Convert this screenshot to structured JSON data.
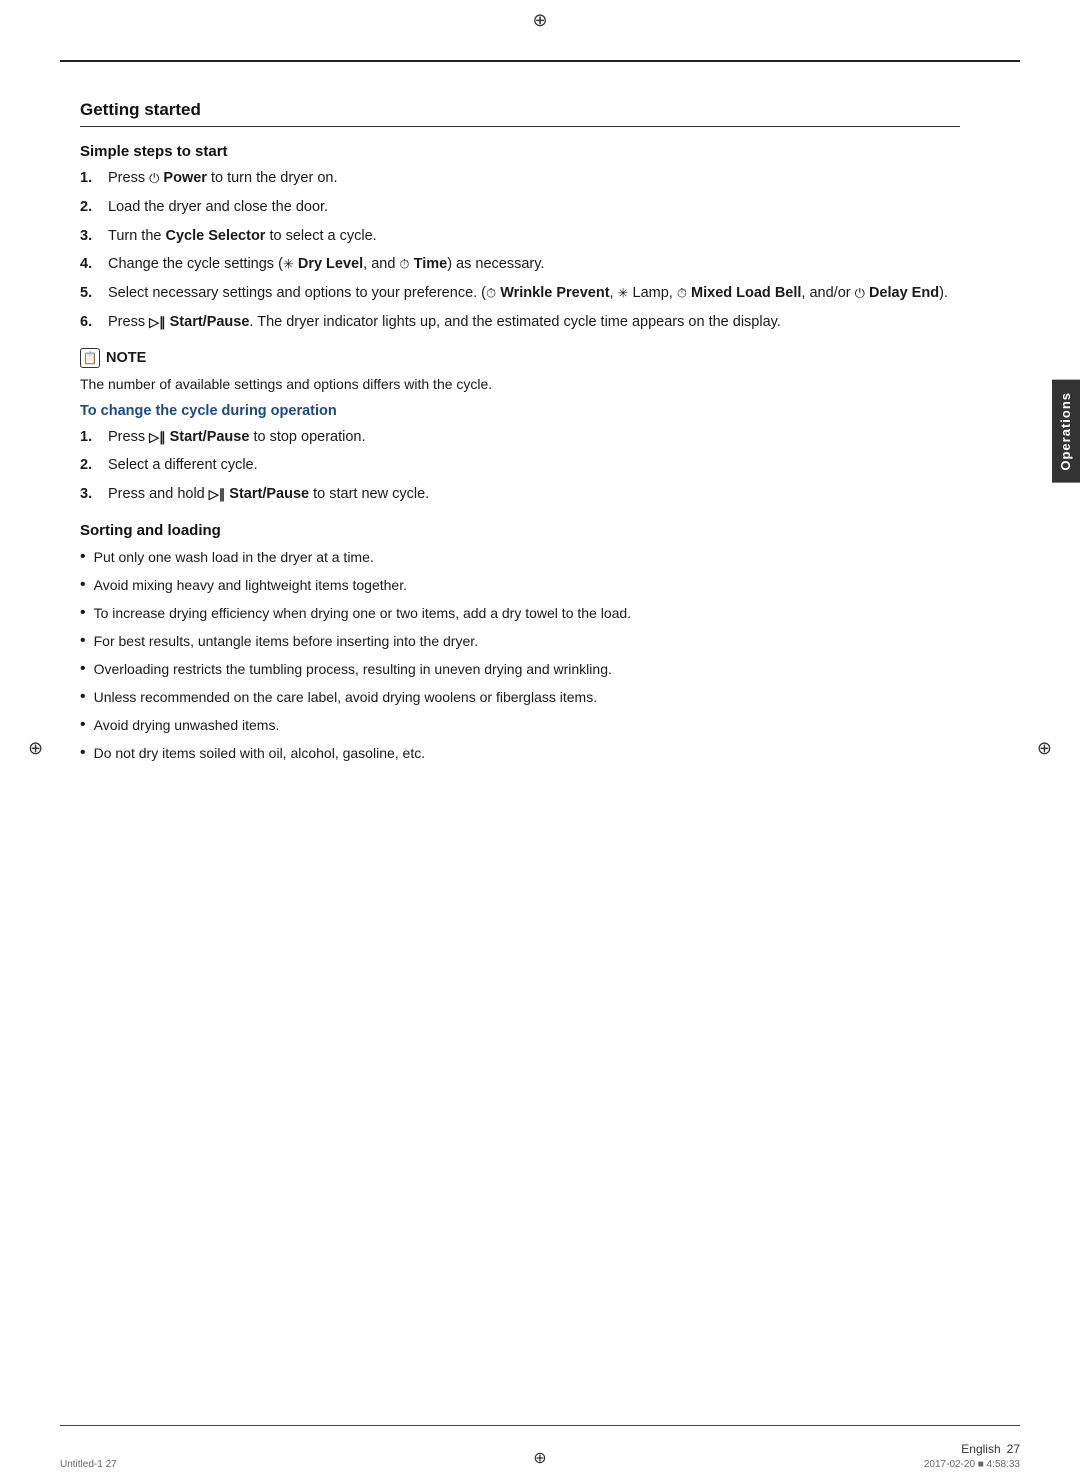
{
  "page": {
    "top_compass": "⊕",
    "left_compass": "⊕",
    "right_compass": "⊕",
    "bottom_compass": "⊕"
  },
  "sidebar": {
    "label": "Operations"
  },
  "section": {
    "title": "Getting started",
    "subsection1": {
      "title": "Simple steps to start",
      "steps": [
        {
          "num": "1.",
          "text": "Press ⏻ Power to turn the dryer on.",
          "bold_parts": [
            "Power"
          ]
        },
        {
          "num": "2.",
          "text": "Load the dryer and close the door."
        },
        {
          "num": "3.",
          "text": "Turn the Cycle Selector to select a cycle.",
          "bold_parts": [
            "Cycle Selector"
          ]
        },
        {
          "num": "4.",
          "text": "Change the cycle settings (✳ Dry Level, and ⏱ Time) as necessary.",
          "bold_parts": [
            "Dry Level",
            "Time"
          ]
        },
        {
          "num": "5.",
          "text": "Select necessary settings and options to your preference. (⏱ Wrinkle Prevent, ✳ Lamp, ⏱ Mixed Load Bell, and/or ⏻ Delay End).",
          "bold_parts": [
            "Wrinkle Prevent",
            "Lamp",
            "Mixed Load Bell",
            "Delay End"
          ]
        },
        {
          "num": "6.",
          "text": "Press ▷∥ Start/Pause. The dryer indicator lights up, and the estimated cycle time appears on the display.",
          "bold_parts": [
            "Start/Pause"
          ]
        }
      ]
    },
    "note": {
      "header": "NOTE",
      "text": "The number of available settings and options differs with the cycle.",
      "subheading": "To change the cycle during operation",
      "sub_steps": [
        {
          "num": "1.",
          "text": "Press ▷∥ Start/Pause to stop operation.",
          "bold_parts": [
            "Start/Pause"
          ]
        },
        {
          "num": "2.",
          "text": "Select a different cycle."
        },
        {
          "num": "3.",
          "text": "Press and hold ▷∥ Start/Pause to start new cycle.",
          "bold_parts": [
            "Start/Pause"
          ]
        }
      ]
    },
    "subsection2": {
      "title": "Sorting and loading",
      "bullets": [
        "Put only one wash load in the dryer at a time.",
        "Avoid mixing heavy and lightweight items together.",
        "To increase drying efficiency when drying one or two items, add a dry towel to the load.",
        "For best results, untangle items before inserting into the dryer.",
        "Overloading restricts the tumbling process, resulting in uneven drying and wrinkling.",
        "Unless recommended on the care label, avoid drying woolens or fiberglass items.",
        "Avoid drying unwashed items.",
        "Do not dry items soiled with oil, alcohol, gasoline, etc."
      ]
    }
  },
  "footer": {
    "language": "English",
    "page_number": "27",
    "file_name": "Untitled-1   27",
    "date_info": "2017-02-20   ■ 4:58:33"
  }
}
